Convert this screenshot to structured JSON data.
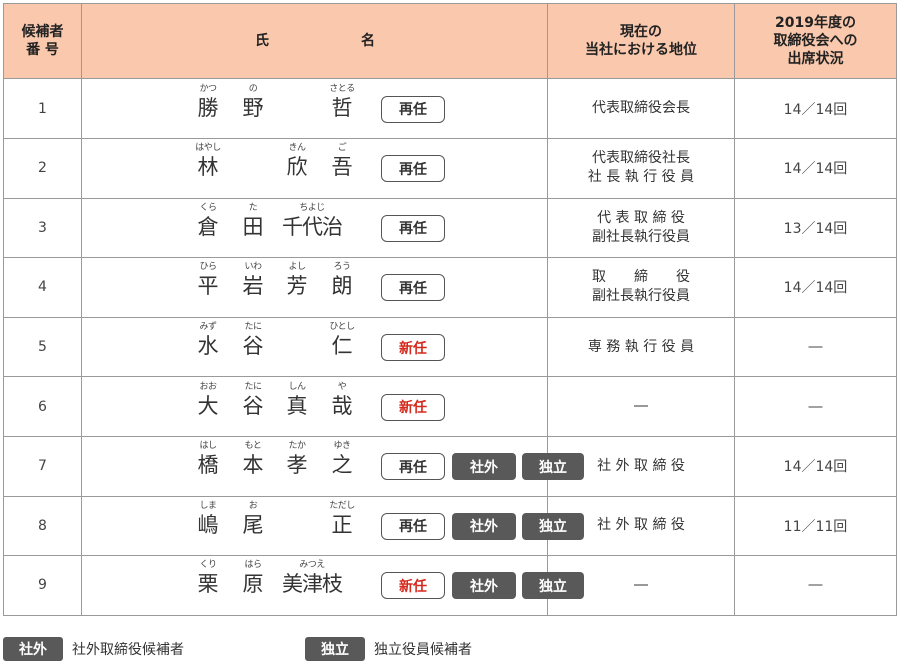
{
  "header": {
    "no": [
      "候補者",
      "番 号"
    ],
    "name_a": "氏",
    "name_b": "名",
    "position": [
      "現在の",
      "当社における地位"
    ],
    "attendance": [
      "2019年度の",
      "取締役会への",
      "出席状況"
    ]
  },
  "rows": [
    {
      "no": "1",
      "name": [
        {
          "ruby": "かつ",
          "kanji": "勝"
        },
        {
          "ruby": "の",
          "kanji": "野"
        },
        {
          "ruby": "",
          "kanji": ""
        },
        {
          "ruby": "さとる",
          "kanji": "哲"
        }
      ],
      "badges": [
        "再任"
      ],
      "position": [
        "代表取締役会長"
      ],
      "attendance": "14／14回"
    },
    {
      "no": "2",
      "name": [
        {
          "ruby": "はやし",
          "kanji": "林"
        },
        {
          "ruby": "",
          "kanji": ""
        },
        {
          "ruby": "きん",
          "kanji": "欣"
        },
        {
          "ruby": "ご",
          "kanji": "吾"
        }
      ],
      "badges": [
        "再任"
      ],
      "position": [
        "代表取締役社長",
        "社 長 執 行 役 員"
      ],
      "attendance": "14／14回"
    },
    {
      "no": "3",
      "name": [
        {
          "ruby": "くら",
          "kanji": "倉"
        },
        {
          "ruby": "た",
          "kanji": "田"
        },
        {
          "ruby": "ちよじ",
          "kanji": "千代治"
        }
      ],
      "badges": [
        "再任"
      ],
      "position": [
        "代 表 取 締 役",
        "副社長執行役員"
      ],
      "attendance": "13／14回"
    },
    {
      "no": "4",
      "name": [
        {
          "ruby": "ひら",
          "kanji": "平"
        },
        {
          "ruby": "いわ",
          "kanji": "岩"
        },
        {
          "ruby": "よし",
          "kanji": "芳"
        },
        {
          "ruby": "ろう",
          "kanji": "朗"
        }
      ],
      "badges": [
        "再任"
      ],
      "position": [
        "取　　締　　役",
        "副社長執行役員"
      ],
      "attendance": "14／14回"
    },
    {
      "no": "5",
      "name": [
        {
          "ruby": "みず",
          "kanji": "水"
        },
        {
          "ruby": "たに",
          "kanji": "谷"
        },
        {
          "ruby": "",
          "kanji": ""
        },
        {
          "ruby": "ひとし",
          "kanji": "仁"
        }
      ],
      "badges": [
        "新任"
      ],
      "position": [
        "専 務 執 行 役 員"
      ],
      "attendance": "―"
    },
    {
      "no": "6",
      "name": [
        {
          "ruby": "おお",
          "kanji": "大"
        },
        {
          "ruby": "たに",
          "kanji": "谷"
        },
        {
          "ruby": "しん",
          "kanji": "真"
        },
        {
          "ruby": "や",
          "kanji": "哉"
        }
      ],
      "badges": [
        "新任"
      ],
      "position": [
        "―"
      ],
      "attendance": "―"
    },
    {
      "no": "7",
      "name": [
        {
          "ruby": "はし",
          "kanji": "橋"
        },
        {
          "ruby": "もと",
          "kanji": "本"
        },
        {
          "ruby": "たか",
          "kanji": "孝"
        },
        {
          "ruby": "ゆき",
          "kanji": "之"
        }
      ],
      "badges": [
        "再任",
        "社外",
        "独立"
      ],
      "position": [
        "社 外 取 締 役"
      ],
      "attendance": "14／14回"
    },
    {
      "no": "8",
      "name": [
        {
          "ruby": "しま",
          "kanji": "嶋"
        },
        {
          "ruby": "お",
          "kanji": "尾"
        },
        {
          "ruby": "",
          "kanji": ""
        },
        {
          "ruby": "ただし",
          "kanji": "正"
        }
      ],
      "badges": [
        "再任",
        "社外",
        "独立"
      ],
      "position": [
        "社 外 取 締 役"
      ],
      "attendance": "11／11回"
    },
    {
      "no": "9",
      "name": [
        {
          "ruby": "くり",
          "kanji": "栗"
        },
        {
          "ruby": "はら",
          "kanji": "原"
        },
        {
          "ruby": "みつえ",
          "kanji": "美津枝"
        }
      ],
      "badges": [
        "新任",
        "社外",
        "独立"
      ],
      "position": [
        "―"
      ],
      "attendance": "―"
    }
  ],
  "legend": [
    {
      "badge": "社外",
      "text": "社外取締役候補者"
    },
    {
      "badge": "独立",
      "text": "独立役員候補者"
    }
  ]
}
